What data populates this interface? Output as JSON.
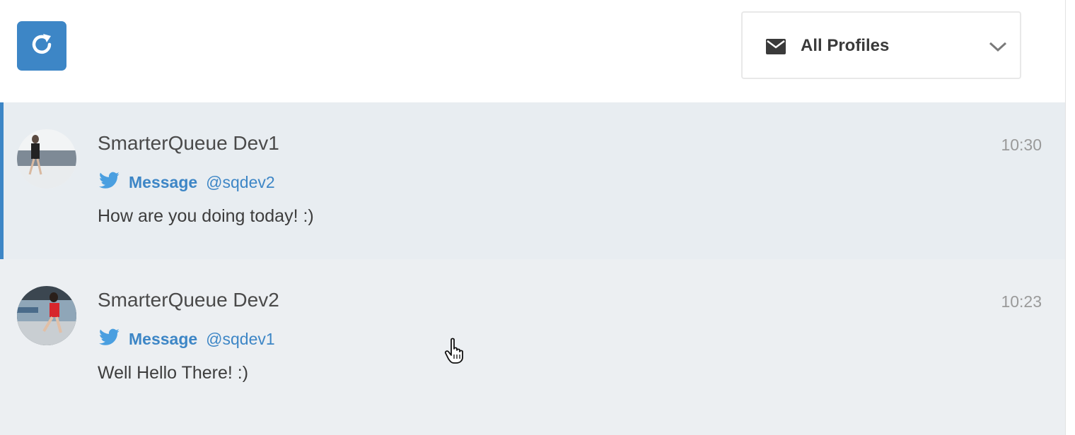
{
  "toolbar": {
    "refresh_icon": "refresh-icon",
    "profile_filter": {
      "icon": "envelope-icon",
      "label": "All Profiles",
      "dropdown_icon": "chevron-down-icon"
    }
  },
  "messages": [
    {
      "name": "SmarterQueue Dev1",
      "time": "10:30",
      "network_icon": "twitter-icon",
      "type": "Message",
      "handle": "@sqdev2",
      "text": "How are you doing today! :)",
      "selected": true
    },
    {
      "name": "SmarterQueue Dev2",
      "time": "10:23",
      "network_icon": "twitter-icon",
      "type": "Message",
      "handle": "@sqdev1",
      "text": "Well Hello There! :)",
      "selected": false
    }
  ],
  "colors": {
    "accent": "#3d86c6",
    "selected_bg": "#e8edf1",
    "twitter": "#4a9fe0"
  }
}
